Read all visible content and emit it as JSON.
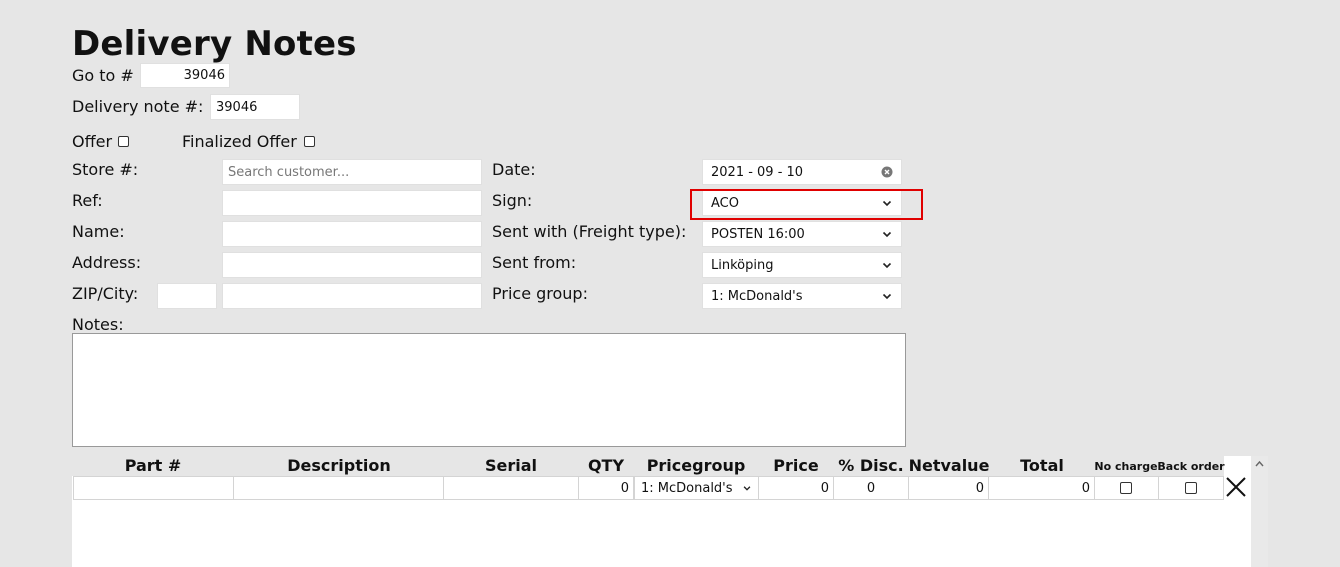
{
  "page": {
    "title": "Delivery Notes"
  },
  "goto": {
    "label": "Go to #",
    "value": "39046"
  },
  "delivery_note": {
    "label": "Delivery note #:",
    "value": "39046"
  },
  "offer": {
    "label": "Offer",
    "checked": false
  },
  "finalized_offer": {
    "label": "Finalized Offer",
    "checked": false
  },
  "left_fields": {
    "store": {
      "label": "Store #:",
      "placeholder": "Search customer...",
      "value": ""
    },
    "ref": {
      "label": "Ref:",
      "value": ""
    },
    "name": {
      "label": "Name:",
      "value": ""
    },
    "address": {
      "label": "Address:",
      "value": ""
    },
    "zipcity": {
      "label": "ZIP/City:",
      "zip": "",
      "city": ""
    }
  },
  "right_fields": {
    "date": {
      "label": "Date:",
      "value": "2021 - 09 - 10"
    },
    "sign": {
      "label": "Sign:",
      "value": "ACO"
    },
    "freight": {
      "label": "Sent with (Freight type):",
      "value": "POSTEN 16:00"
    },
    "sent_from": {
      "label": "Sent from:",
      "value": "Linköping"
    },
    "price_group": {
      "label": "Price group:",
      "value": "1: McDonald's"
    }
  },
  "notes": {
    "label": "Notes:",
    "value": ""
  },
  "table": {
    "headers": {
      "part": "Part #",
      "description": "Description",
      "serial": "Serial",
      "qty": "QTY",
      "pricegroup": "Pricegroup",
      "price": "Price",
      "disc": "% Disc.",
      "netvalue": "Netvalue",
      "total": "Total",
      "no_charge": "No charge",
      "back_order": "Back order"
    },
    "row": {
      "part": "",
      "description": "",
      "serial": "",
      "qty": "0",
      "pricegroup": "1: McDonald's",
      "price": "0",
      "disc": "0",
      "netvalue": "0",
      "total": "0",
      "no_charge": false,
      "back_order": false
    }
  },
  "colors": {
    "highlight": "#e00000",
    "background": "#e6e6e6"
  },
  "icons": {
    "clear": "clear-circle-icon",
    "dropdown": "chevron-down-icon",
    "delete": "close-x-icon",
    "scroll_up": "chevron-up-icon"
  }
}
